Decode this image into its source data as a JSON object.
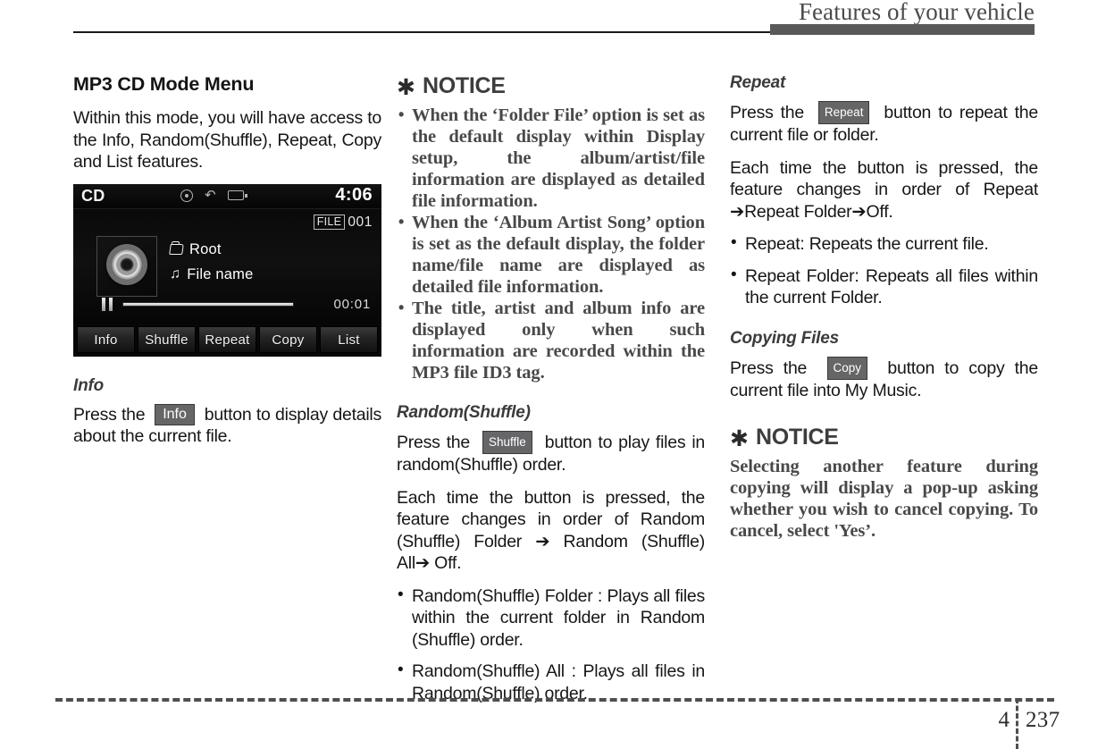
{
  "header": {
    "title": "Features of your vehicle"
  },
  "footer": {
    "chapter": "4",
    "page": "237"
  },
  "column_left": {
    "section_title": "MP3 CD Mode Menu",
    "intro": "Within this mode, you will have access to the Info, Random(Shuffle), Repeat, Copy and List features.",
    "info": {
      "heading": "Info",
      "text_before": "Press the",
      "keycap": "Info",
      "text_after": "button to display details about the current file."
    }
  },
  "head_unit": {
    "source": "CD",
    "clock": "4:06",
    "file_tag": "FILE",
    "file_number": "001",
    "folder_name": "Root",
    "file_name": "File name",
    "elapsed": "00:01",
    "icons": [
      "disc-icon",
      "usb-icon",
      "device-icon",
      "pause-icon",
      "folder-icon",
      "music-note-icon"
    ],
    "buttons": [
      "Info",
      "Shuffle",
      "Repeat",
      "Copy",
      "List"
    ]
  },
  "column_middle": {
    "notice": {
      "star": "✱",
      "title": "NOTICE",
      "bullets": [
        "When the ‘Folder File’ option is set as the default display within Display setup, the album/artist/file information are displayed as detailed file information.",
        "When the ‘Album Artist Song’ option is set as the default display, the folder name/file name are displayed as detailed file information.",
        "The title, artist and album info are displayed only when such information are recorded within the MP3 file ID3 tag."
      ]
    },
    "random": {
      "heading": "Random(Shuffle)",
      "press_before": "Press the",
      "keycap": "Shuffle",
      "press_after": "button to play files in random(Shuffle) order.",
      "each_time": "Each time the button is pressed, the feature changes in order of Random (Shuffle) Folder ➔ Random (Shuffle) All➔ Off.",
      "bullets": [
        "Random(Shuffle) Folder : Plays all files within the current folder in Random (Shuffle) order.",
        "Random(Shuffle) All : Plays all files in Random(Shuffle) order."
      ]
    }
  },
  "column_right": {
    "repeat": {
      "heading": "Repeat",
      "press_before": "Press the",
      "keycap": "Repeat",
      "press_after": "button to repeat the current file or folder.",
      "each_time": "Each time the button is pressed, the feature changes in order of Repeat ➔Repeat Folder➔Off.",
      "bullets": [
        "Repeat: Repeats the current file.",
        "Repeat Folder: Repeats all files within the current Folder."
      ]
    },
    "copying": {
      "heading": "Copying Files",
      "press_before": "Press the",
      "keycap": "Copy",
      "press_after": "button to copy the current file into My Music."
    },
    "notice": {
      "star": "✱",
      "title": "NOTICE",
      "text": "Selecting another feature during copying will display a pop-up asking whether you wish to cancel copying. To cancel, select 'Yes’."
    }
  }
}
